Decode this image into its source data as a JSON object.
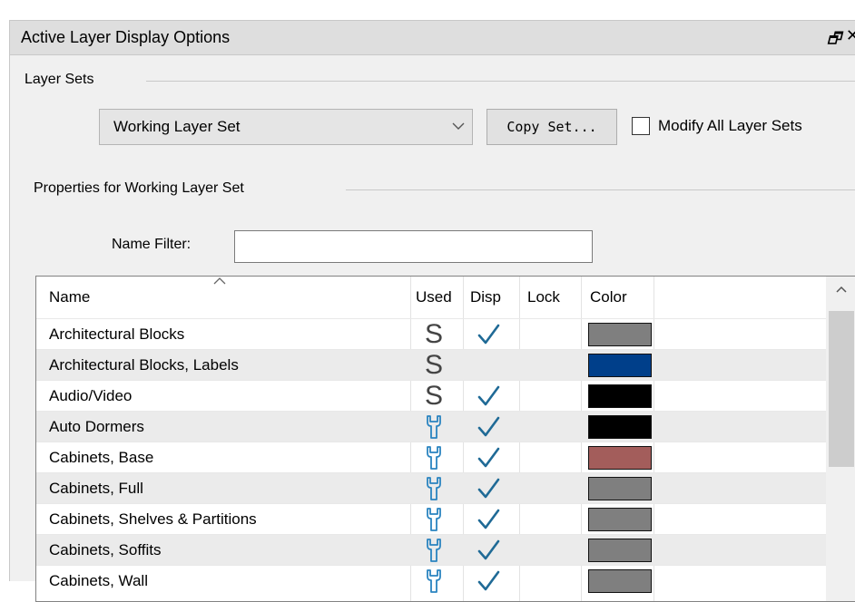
{
  "window": {
    "title": "Active Layer Display Options",
    "float_icon": "restore-icon",
    "float_glyph": "🗗",
    "close_glyph": "✕"
  },
  "layer_sets": {
    "group_label": "Layer Sets",
    "selected": "Working Layer Set",
    "copy_button": "Copy Set...",
    "modify_all_label": "Modify All Layer Sets",
    "modify_all_checked": false
  },
  "properties": {
    "group_label": "Properties for  Working Layer Set",
    "name_filter_label": "Name Filter:",
    "name_filter_value": ""
  },
  "table": {
    "columns": [
      "Name",
      "Used",
      "Disp",
      "Lock",
      "Color"
    ],
    "rows": [
      {
        "name": "Architectural Blocks",
        "used": "S",
        "disp": true,
        "lock": false,
        "color": "#7f7f7f"
      },
      {
        "name": "Architectural Blocks, Labels",
        "used": "S",
        "disp": false,
        "lock": false,
        "color": "#003f8a"
      },
      {
        "name": "Audio/Video",
        "used": "S",
        "disp": true,
        "lock": false,
        "color": "#000000"
      },
      {
        "name": "Auto Dormers",
        "used": "wrench",
        "disp": true,
        "lock": false,
        "color": "#000000"
      },
      {
        "name": "Cabinets,  Base",
        "used": "wrench",
        "disp": true,
        "lock": false,
        "color": "#a35d5b"
      },
      {
        "name": "Cabinets,  Full",
        "used": "wrench",
        "disp": true,
        "lock": false,
        "color": "#7f7f7f"
      },
      {
        "name": "Cabinets,  Shelves & Partitions",
        "used": "wrench",
        "disp": true,
        "lock": false,
        "color": "#7f7f7f"
      },
      {
        "name": "Cabinets,  Soffits",
        "used": "wrench",
        "disp": true,
        "lock": false,
        "color": "#7f7f7f"
      },
      {
        "name": "Cabinets,  Wall",
        "used": "wrench",
        "disp": true,
        "lock": false,
        "color": "#7f7f7f"
      }
    ]
  },
  "colors": {
    "accent_check": "#1f6a96",
    "wrench": "#2a84c0"
  }
}
